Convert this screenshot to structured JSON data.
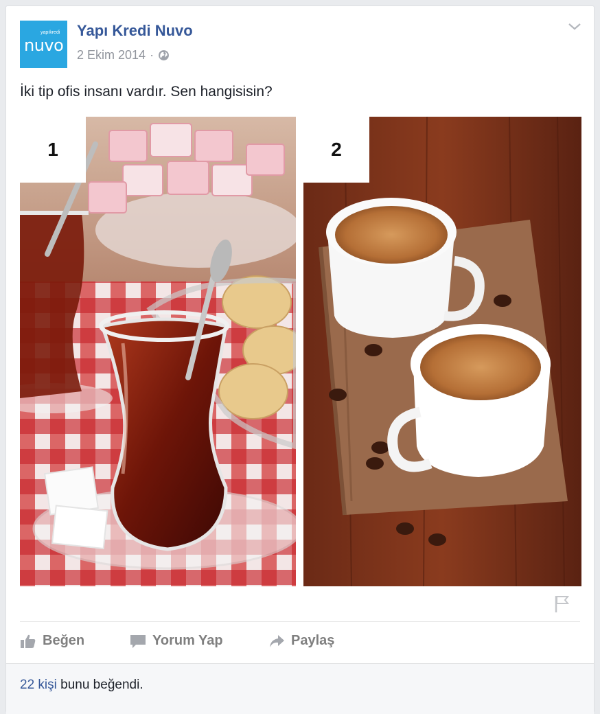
{
  "post": {
    "page_name": "Yapı Kredi Nuvo",
    "date": "2 Ekim 2014",
    "separator": "·",
    "text": "İki tip ofis insanı vardır. Sen hangisisin?",
    "avatar": {
      "top_text": "yapıkredi",
      "word": "nuvo"
    },
    "photos": [
      {
        "label": "1",
        "subject": "turkish-tea"
      },
      {
        "label": "2",
        "subject": "turkish-coffee"
      }
    ]
  },
  "actions": {
    "like": "Beğen",
    "comment": "Yorum Yap",
    "share": "Paylaş"
  },
  "likes": {
    "count_text": "22 kişi",
    "rest_text": " bunu beğendi."
  },
  "colors": {
    "link": "#365899",
    "muted": "#90949c",
    "avatar_bg": "#2aa7e1"
  }
}
